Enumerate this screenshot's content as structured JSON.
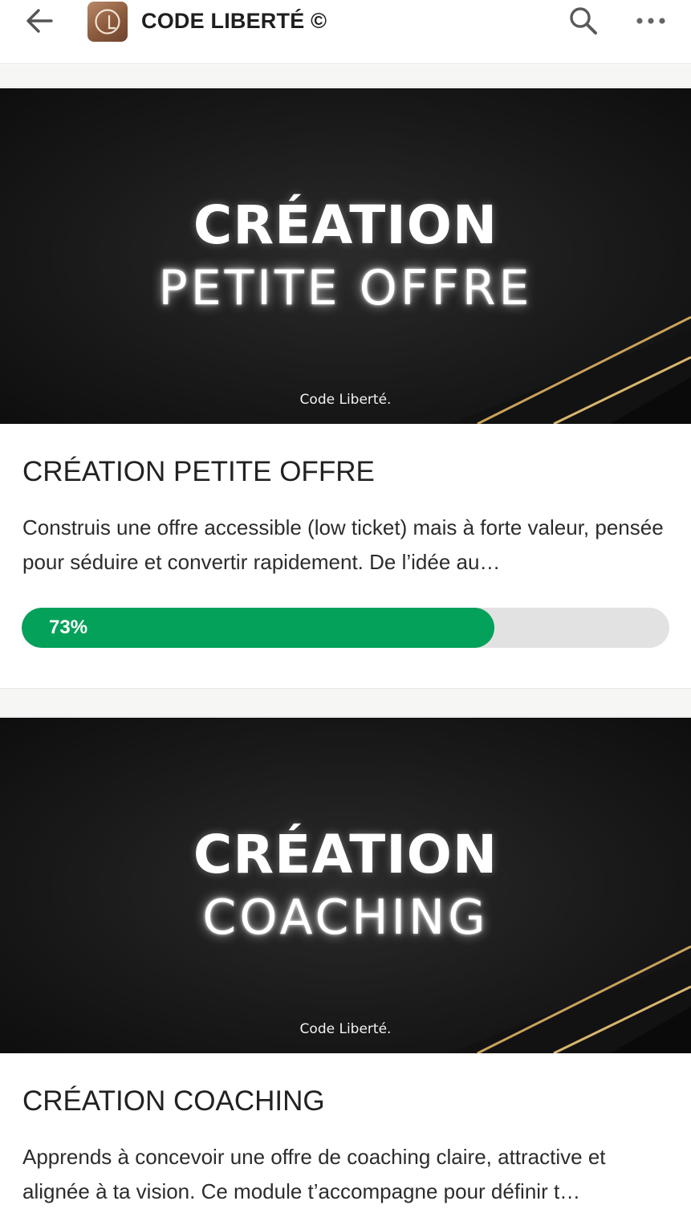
{
  "app": {
    "title": "CODE LIBERTÉ ©"
  },
  "icons": {
    "back": "arrow-left-icon",
    "logo": "code-liberte-logo",
    "search": "search-icon",
    "more": "more-horizontal-icon"
  },
  "colors": {
    "progress_fill": "#04a15a",
    "progress_track": "#e2e2e2",
    "banner_bg": "#1a1a1a",
    "gold_stripe": "#c9a45c"
  },
  "courses": [
    {
      "banner_title": "CRÉATION",
      "banner_subtitle": "PETITE OFFRE",
      "banner_brand": "Code Liberté.",
      "title": "CRÉATION PETITE OFFRE",
      "description": "Construis une offre accessible (low ticket) mais à forte valeur, pensée pour séduire et convertir rapidement. De l’idée au…",
      "progress": 73,
      "progress_label": "73%"
    },
    {
      "banner_title": "CRÉATION",
      "banner_subtitle": "COACHING",
      "banner_brand": "Code Liberté.",
      "title": "CRÉATION COACHING",
      "description": "Apprends à concevoir une offre de coaching claire, attractive et alignée à ta vision. Ce module t’accompagne pour définir t…"
    }
  ]
}
